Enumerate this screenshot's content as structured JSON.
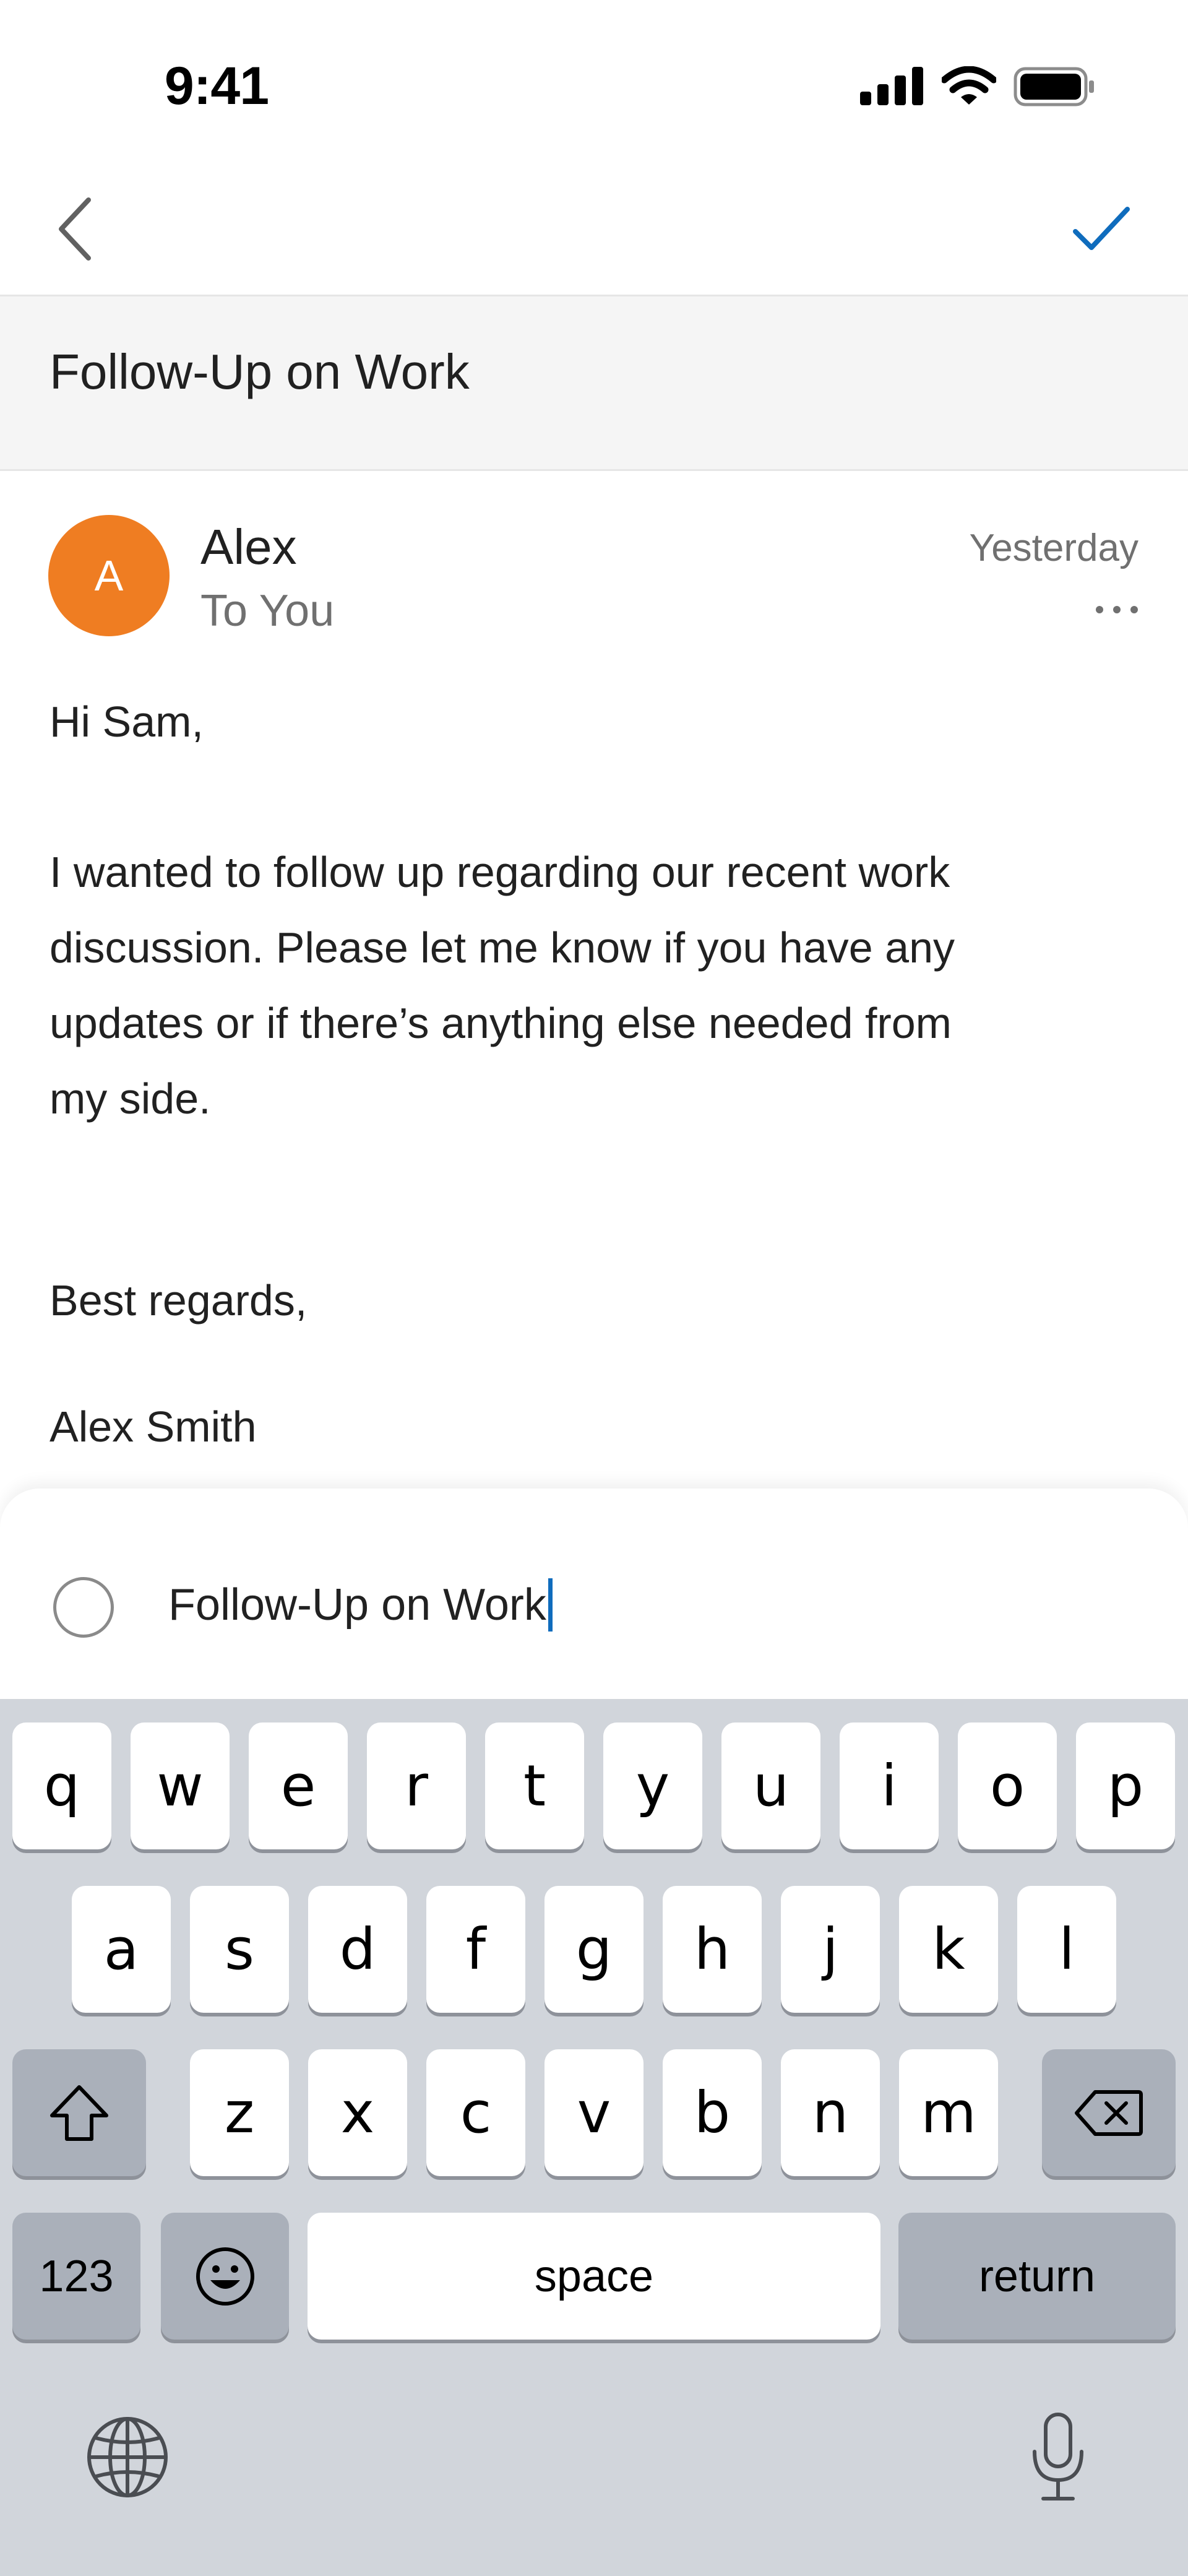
{
  "status_bar": {
    "time": "9:41"
  },
  "nav": {
    "back_icon": "chevron-left-icon",
    "confirm_icon": "checkmark-icon",
    "accent": "#0f6cbd"
  },
  "subject": "Follow-Up on Work",
  "message": {
    "avatar_initial": "A",
    "avatar_color": "#ef7d22",
    "sender": "Alex",
    "recipient": "To You",
    "time": "Yesterday",
    "body": {
      "greeting": "Hi Sam,",
      "line1": "I wanted to follow up regarding our recent work",
      "line2": "discussion. Please let me know if you have any",
      "line3": "updates or if there’s anything else needed from",
      "line4": "my side.",
      "closing": "Best regards,",
      "signature": "Alex Smith"
    }
  },
  "task_sheet": {
    "input_value": "Follow-Up on Work"
  },
  "keyboard": {
    "row1": [
      "q",
      "w",
      "e",
      "r",
      "t",
      "y",
      "u",
      "i",
      "o",
      "p"
    ],
    "row2": [
      "a",
      "s",
      "d",
      "f",
      "g",
      "h",
      "j",
      "k",
      "l"
    ],
    "row3": [
      "z",
      "x",
      "c",
      "v",
      "b",
      "n",
      "m"
    ],
    "numbers_label": "123",
    "space_label": "space",
    "return_label": "return"
  }
}
